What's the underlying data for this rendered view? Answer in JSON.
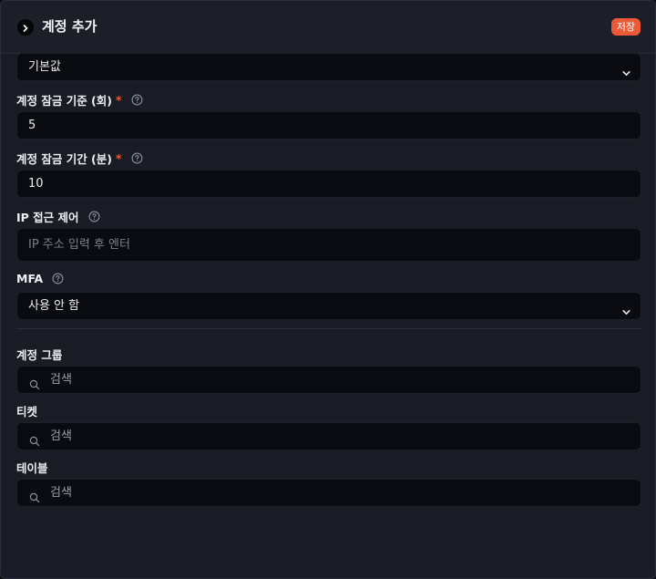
{
  "header": {
    "title": "계정 추가",
    "save_label": "저장"
  },
  "fields": {
    "default_select": {
      "value": "기본값"
    },
    "lock_threshold": {
      "label": "계정 잠금 기준 (회)",
      "required": "*",
      "value": "5"
    },
    "lock_duration": {
      "label": "계정 잠금 기간 (분)",
      "required": "*",
      "value": "10"
    },
    "ip_access": {
      "label": "IP 접근 제어",
      "placeholder": "IP 주소 입력 후 엔터"
    },
    "mfa": {
      "label": "MFA",
      "value": "사용 안 함"
    }
  },
  "groups": {
    "account_group": {
      "label": "계정 그룹",
      "placeholder": "검색"
    },
    "ticket": {
      "label": "티켓",
      "placeholder": "검색"
    },
    "table": {
      "label": "테이블",
      "placeholder": "검색"
    }
  },
  "colors": {
    "accent": "#ee5a36",
    "panel": "#1a1c25",
    "input_bg": "#0a0b10"
  }
}
